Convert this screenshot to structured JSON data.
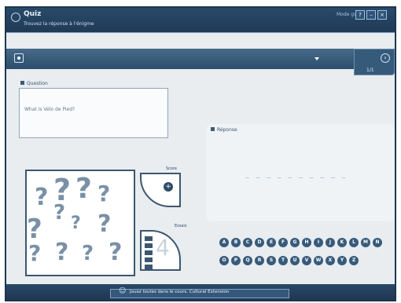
{
  "app": {
    "title": "Quiz",
    "subtitle": "Trouvez la réponse à l'énigme",
    "mode": "Mode guidé"
  },
  "windowButtons": [
    "?",
    "–",
    "×"
  ],
  "navigation": {
    "counter": "1/1",
    "next_icon": "arrow-right-icon"
  },
  "question": {
    "label": "Question",
    "text": "What is Vélo de Pied?"
  },
  "response": {
    "label": "Réponse",
    "blanks": "_ _ _ _ _ _   _ _ _ _"
  },
  "scorePanel": {
    "label": "Score",
    "triesLabel": "Essais",
    "number": "4"
  },
  "letters": [
    "A",
    "B",
    "C",
    "D",
    "E",
    "F",
    "G",
    "H",
    "I",
    "J",
    "K",
    "L",
    "M",
    "N",
    "O",
    "P",
    "Q",
    "R",
    "S",
    "T",
    "U",
    "V",
    "W",
    "X",
    "Y",
    "Z"
  ],
  "footer": {
    "text": "Jouez toutes dans le cours. Cultural Extension"
  },
  "colors": {
    "frame": "#1e3550",
    "accent": "#385b7b",
    "panel": "#e9edf0"
  }
}
